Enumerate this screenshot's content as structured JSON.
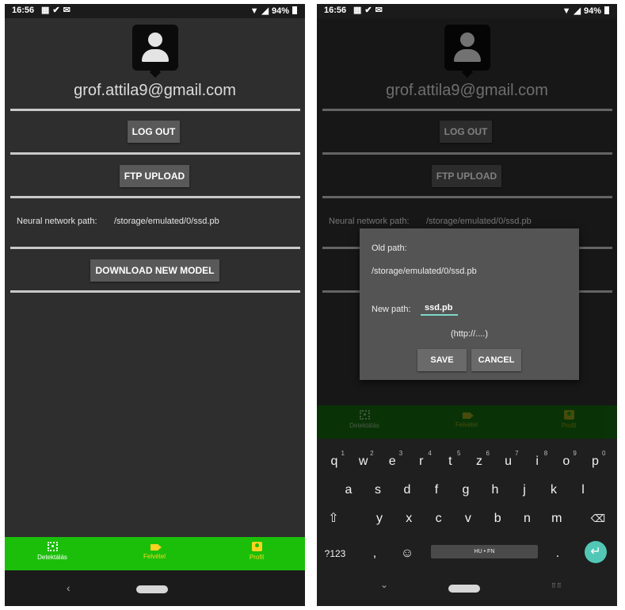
{
  "status_bar": {
    "time": "16:56",
    "icons": [
      "calendar-icon",
      "check-icon",
      "gmail-icon"
    ],
    "battery": "94%"
  },
  "profile": {
    "email": "grof.attila9@gmail.com",
    "logout_label": "LOG OUT",
    "ftp_label": "FTP UPLOAD",
    "nn_path_label": "Neural network path:",
    "nn_path_value": "/storage/emulated/0/ssd.pb",
    "download_label": "DOWNLOAD NEW MODEL"
  },
  "bottom_nav": {
    "items": [
      {
        "label": "Detektálás",
        "icon": "scan-icon"
      },
      {
        "label": "Felvétel",
        "icon": "camera-icon"
      },
      {
        "label": "Profil",
        "icon": "profile-icon",
        "active": true
      }
    ]
  },
  "dialog": {
    "old_path_label": "Old path:",
    "old_path_value": "/storage/emulated/0/ssd.pb",
    "new_path_label": "New path:",
    "new_path_value": "ssd.pb",
    "hint": "(http://....)",
    "save_label": "SAVE",
    "cancel_label": "CANCEL"
  },
  "keyboard": {
    "row1": [
      {
        "k": "q",
        "n": "1"
      },
      {
        "k": "w",
        "n": "2"
      },
      {
        "k": "e",
        "n": "3"
      },
      {
        "k": "r",
        "n": "4"
      },
      {
        "k": "t",
        "n": "5"
      },
      {
        "k": "z",
        "n": "6"
      },
      {
        "k": "u",
        "n": "7"
      },
      {
        "k": "i",
        "n": "8"
      },
      {
        "k": "o",
        "n": "9"
      },
      {
        "k": "p",
        "n": "0"
      }
    ],
    "row2": [
      "a",
      "s",
      "d",
      "f",
      "g",
      "h",
      "j",
      "k",
      "l"
    ],
    "row3": [
      "y",
      "x",
      "c",
      "v",
      "b",
      "n",
      "m"
    ],
    "symbols_label": "?123",
    "comma": ",",
    "period": ".",
    "space_label": "HU • FN"
  },
  "colors": {
    "nav_green": "#1bbf0a",
    "active_yellow": "#ffd21f",
    "accent_teal": "#52c7b5"
  }
}
